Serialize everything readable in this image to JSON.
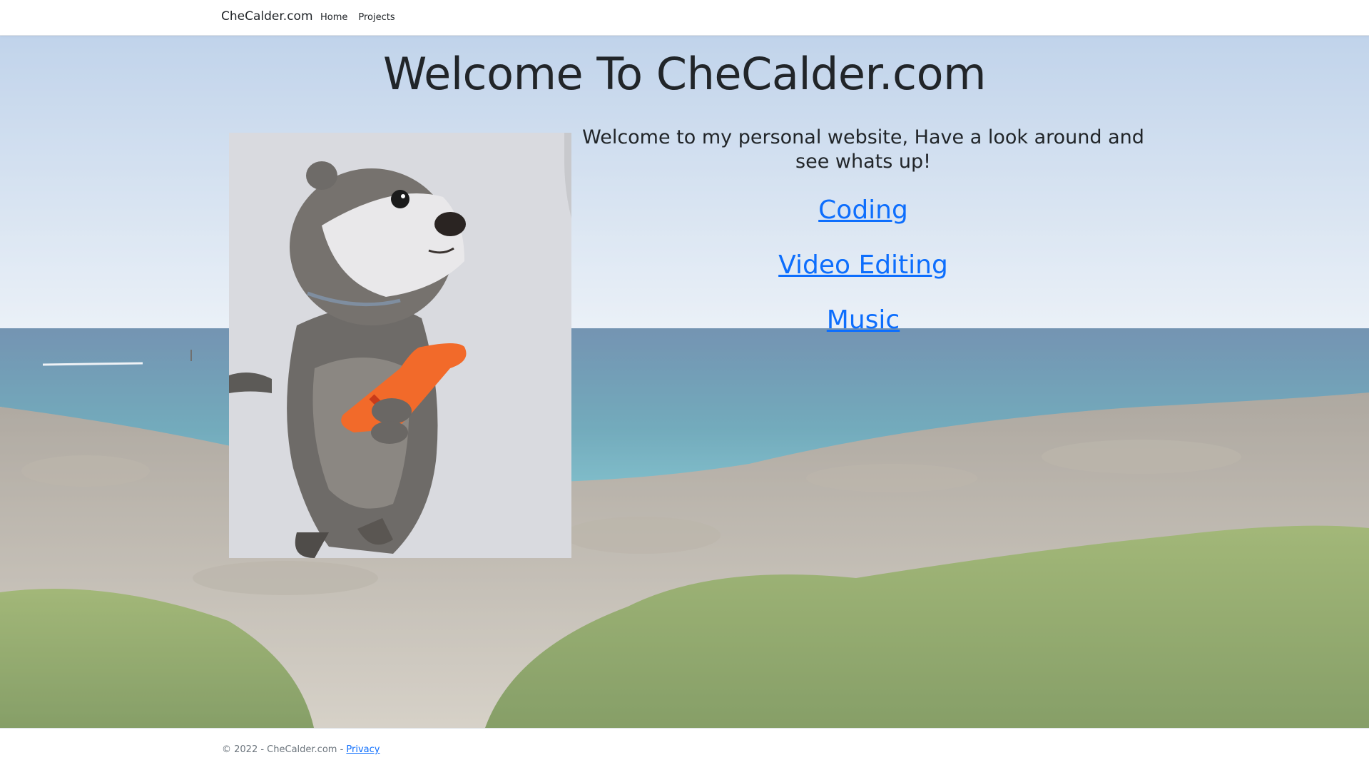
{
  "navbar": {
    "brand": "CheCalder.com",
    "links": [
      {
        "label": "Home"
      },
      {
        "label": "Projects"
      }
    ]
  },
  "main": {
    "title": "Welcome To CheCalder.com",
    "intro": "Welcome to my personal website, Have a look around and see whats up!",
    "links": [
      {
        "label": "Coding"
      },
      {
        "label": "Video Editing"
      },
      {
        "label": "Music"
      }
    ],
    "image": {
      "subject": "otter holding a toy guitar"
    },
    "background": {
      "subject": "rocky coastline with sea and green shrubs"
    }
  },
  "footer": {
    "copyright": "© 2022 - CheCalder.com - ",
    "privacy_label": "Privacy"
  },
  "colors": {
    "link": "#0d6efd",
    "text": "#212529",
    "muted": "#6c757d"
  }
}
